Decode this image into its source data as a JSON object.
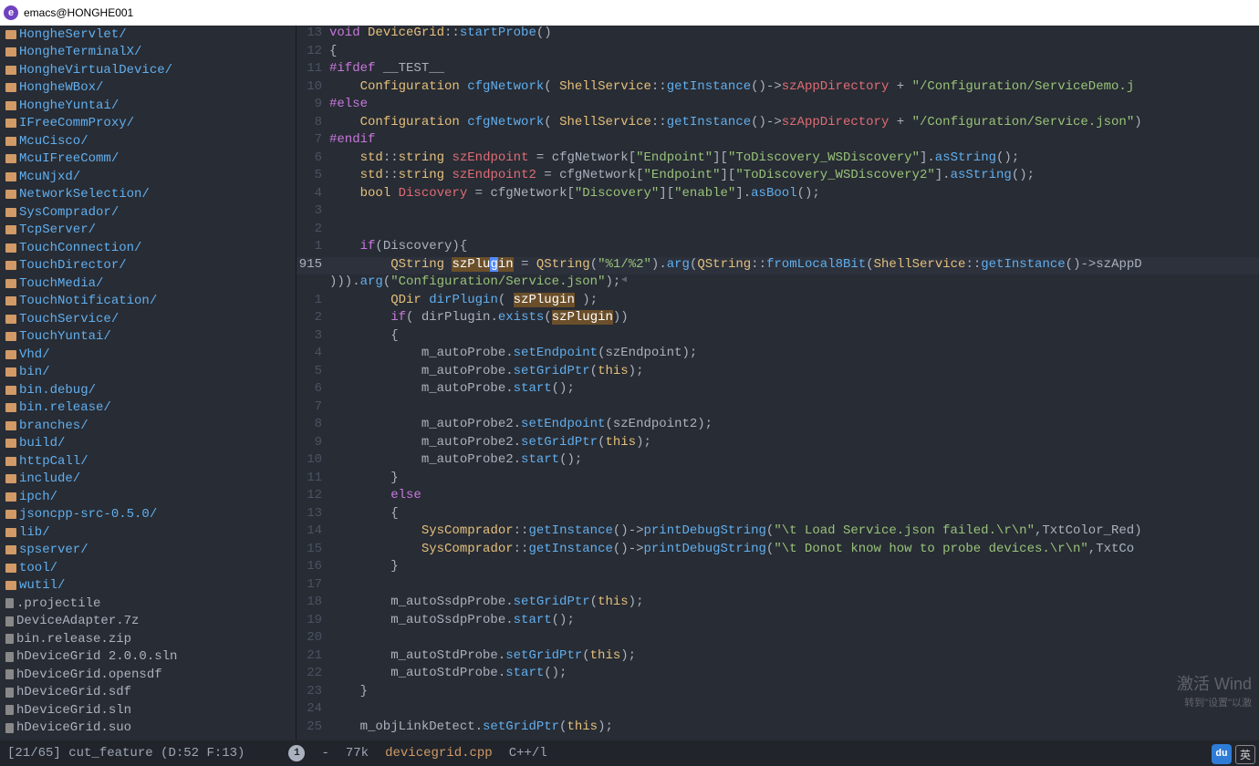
{
  "title": "emacs@HONGHE001",
  "sidebar": {
    "items": [
      {
        "type": "dir",
        "name": "HongheServlet/"
      },
      {
        "type": "dir",
        "name": "HongheTerminalX/"
      },
      {
        "type": "dir",
        "name": "HongheVirtualDevice/"
      },
      {
        "type": "dir",
        "name": "HongheWBox/"
      },
      {
        "type": "dir",
        "name": "HongheYuntai/"
      },
      {
        "type": "dir",
        "name": "IFreeCommProxy/"
      },
      {
        "type": "dir",
        "name": "McuCisco/"
      },
      {
        "type": "dir",
        "name": "McuIFreeComm/"
      },
      {
        "type": "dir",
        "name": "McuNjxd/"
      },
      {
        "type": "dir",
        "name": "NetworkSelection/"
      },
      {
        "type": "dir",
        "name": "SysComprador/"
      },
      {
        "type": "dir",
        "name": "TcpServer/"
      },
      {
        "type": "dir",
        "name": "TouchConnection/"
      },
      {
        "type": "dir",
        "name": "TouchDirector/"
      },
      {
        "type": "dir",
        "name": "TouchMedia/"
      },
      {
        "type": "dir",
        "name": "TouchNotification/"
      },
      {
        "type": "dir",
        "name": "TouchService/"
      },
      {
        "type": "dir",
        "name": "TouchYuntai/"
      },
      {
        "type": "dir",
        "name": "Vhd/"
      },
      {
        "type": "dir",
        "name": "bin/"
      },
      {
        "type": "dir",
        "name": "bin.debug/"
      },
      {
        "type": "dir",
        "name": "bin.release/"
      },
      {
        "type": "dir",
        "name": "branches/"
      },
      {
        "type": "dir",
        "name": "build/"
      },
      {
        "type": "dir",
        "name": "httpCall/"
      },
      {
        "type": "dir",
        "name": "include/"
      },
      {
        "type": "dir",
        "name": "ipch/"
      },
      {
        "type": "dir",
        "name": "jsoncpp-src-0.5.0/"
      },
      {
        "type": "dir",
        "name": "lib/"
      },
      {
        "type": "dir",
        "name": "spserver/"
      },
      {
        "type": "dir",
        "name": "tool/"
      },
      {
        "type": "dir",
        "name": "wutil/"
      },
      {
        "type": "file",
        "name": ".projectile"
      },
      {
        "type": "file",
        "name": "DeviceAdapter.7z"
      },
      {
        "type": "file",
        "name": "bin.release.zip"
      },
      {
        "type": "file",
        "name": "hDeviceGrid 2.0.0.sln"
      },
      {
        "type": "file",
        "name": "hDeviceGrid.opensdf"
      },
      {
        "type": "file",
        "name": "hDeviceGrid.sdf"
      },
      {
        "type": "file",
        "name": "hDeviceGrid.sln"
      },
      {
        "type": "file",
        "name": "hDeviceGrid.suo"
      }
    ]
  },
  "editor": {
    "current_line_number": "915",
    "lines": [
      {
        "num": "13"
      },
      {
        "num": "12"
      },
      {
        "num": "11"
      },
      {
        "num": "10"
      },
      {
        "num": "9"
      },
      {
        "num": "8"
      },
      {
        "num": "7"
      },
      {
        "num": "6"
      },
      {
        "num": "5"
      },
      {
        "num": "4"
      },
      {
        "num": "3"
      },
      {
        "num": "2"
      },
      {
        "num": "1"
      },
      {
        "num": "915"
      },
      {
        "num": ""
      },
      {
        "num": "1"
      },
      {
        "num": "2"
      },
      {
        "num": "3"
      },
      {
        "num": "4"
      },
      {
        "num": "5"
      },
      {
        "num": "6"
      },
      {
        "num": "7"
      },
      {
        "num": "8"
      },
      {
        "num": "9"
      },
      {
        "num": "10"
      },
      {
        "num": "11"
      },
      {
        "num": "12"
      },
      {
        "num": "13"
      },
      {
        "num": "14"
      },
      {
        "num": "15"
      },
      {
        "num": "16"
      },
      {
        "num": "17"
      },
      {
        "num": "18"
      },
      {
        "num": "19"
      },
      {
        "num": "20"
      },
      {
        "num": "21"
      },
      {
        "num": "22"
      },
      {
        "num": "23"
      },
      {
        "num": "24"
      },
      {
        "num": "25"
      }
    ]
  },
  "statusbar": {
    "pos": "[21/65]",
    "branch": "cut_feature",
    "flycheck": "(D:52 F:13)",
    "circle": "1",
    "dash": "-",
    "size": "77k",
    "file": "devicegrid.cpp",
    "mode": "C++/l"
  },
  "watermark": {
    "line1": "激活 Wind",
    "line2": "转到\"设置\"以激"
  },
  "tray": {
    "du": "du",
    "lang": "英"
  }
}
